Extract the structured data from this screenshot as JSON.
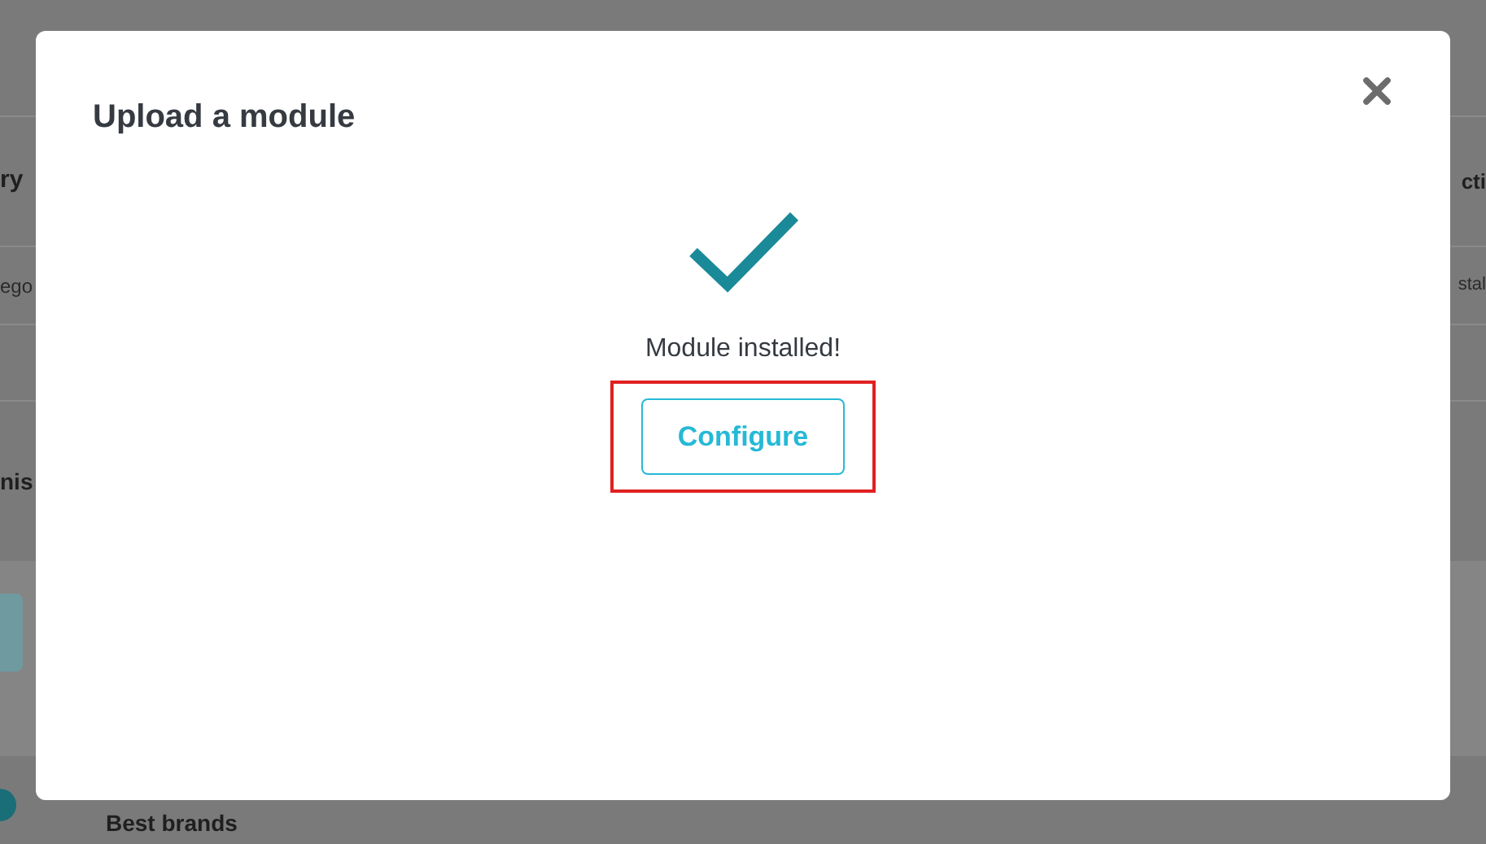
{
  "background": {
    "left_header": "ry",
    "left_cell": "ego",
    "left_heading": "nis",
    "right_header": "cti",
    "right_cell": "stal",
    "section_title": "Best brands"
  },
  "modal": {
    "title": "Upload a module",
    "message": "Module installed!",
    "button": {
      "label": "Configure",
      "highlighted": true
    }
  }
}
